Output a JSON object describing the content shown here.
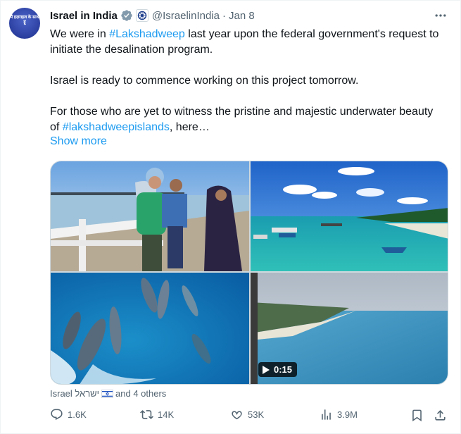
{
  "tweet": {
    "author_name": "Israel in India",
    "handle": "@IsraelinIndia",
    "separator": "·",
    "date": "Jan 8",
    "avatar_text": "मैं इज़राइल के साथ हूं",
    "text": {
      "p1_a": "We were in ",
      "p1_tag": "#Lakshadweep",
      "p1_b": " last year upon the federal government's request to initiate the desalination program.",
      "p2": "Israel is ready to commence working on this project tomorrow.",
      "p3_a": "For those who are yet to witness the pristine and majestic underwater beauty of ",
      "p3_tag": "#lakshadweepislands",
      "p3_b": ", here…"
    },
    "show_more": "Show more",
    "media": {
      "video_duration": "0:15"
    },
    "tagged": {
      "prefix": "Israel ישראל",
      "suffix": "and 4 others"
    },
    "stats": {
      "replies": "1.6K",
      "reposts": "14K",
      "likes": "53K",
      "views": "3.9M"
    }
  },
  "colors": {
    "link": "#1d9bf0",
    "secondary_text": "#536471",
    "verified": "#829aab"
  },
  "icons": [
    "verified-badge-icon",
    "affiliate-badge-icon",
    "more-icon",
    "play-icon",
    "israel-flag-icon",
    "reply-icon",
    "repost-icon",
    "like-icon",
    "views-icon",
    "bookmark-icon",
    "share-icon"
  ]
}
